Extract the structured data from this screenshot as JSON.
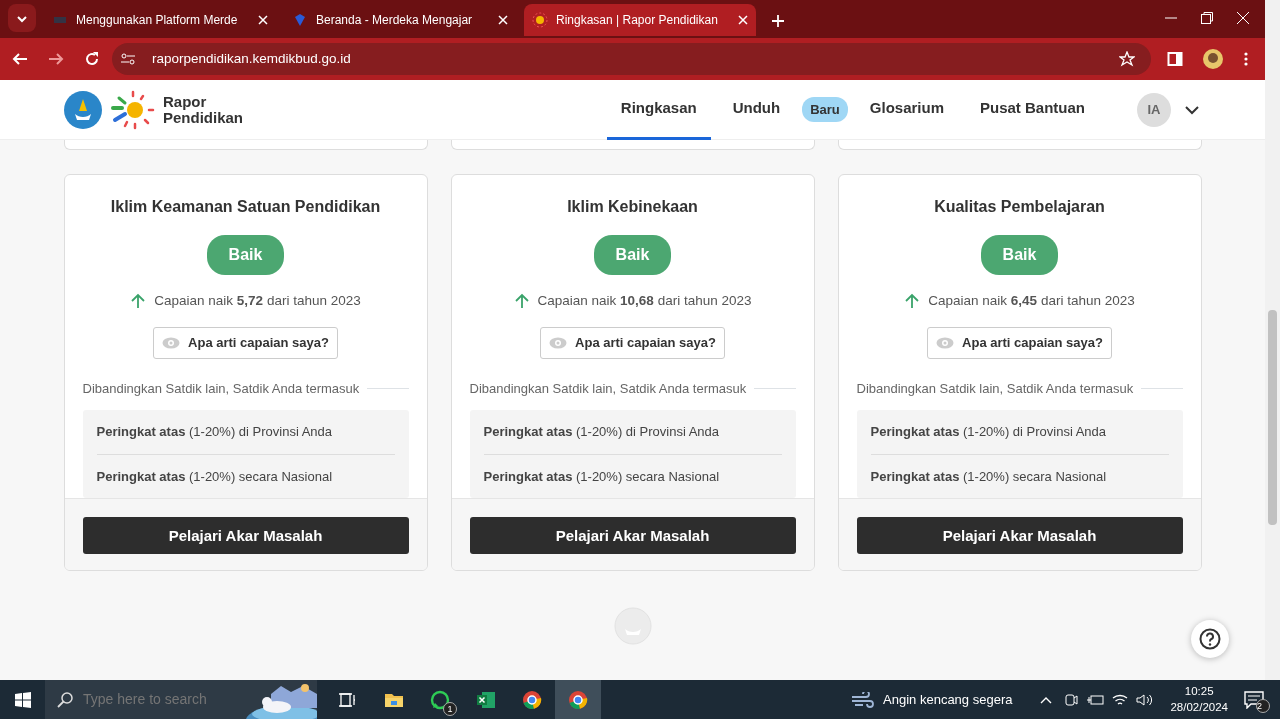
{
  "browser": {
    "tabs": [
      {
        "title": "Menggunakan Platform Merde",
        "selected": false
      },
      {
        "title": "Beranda - Merdeka Mengajar",
        "selected": false
      },
      {
        "title": "Ringkasan | Rapor Pendidikan",
        "selected": true
      }
    ],
    "address": "raporpendidikan.kemdikbud.go.id"
  },
  "header": {
    "brand": [
      "Rapor",
      "Pendidikan"
    ],
    "nav": [
      {
        "label": "Ringkasan",
        "selected": true
      },
      {
        "label": "Unduh",
        "selected": false,
        "badge": "Baru"
      },
      {
        "label": "Glosarium",
        "selected": false
      },
      {
        "label": "Pusat Bantuan",
        "selected": false
      }
    ],
    "avatar": "IA"
  },
  "cards": [
    {
      "title": "Iklim Keamanan Satuan Pendidikan",
      "rating": "Baik",
      "change": "Capaian naik **5,72** dari tahun 2023",
      "info_button": "Apa arti capaian saya?",
      "comparison_label": "Dibandingkan Satdik lain, Satdik Anda termasuk",
      "rankings": [
        "**Peringkat atas** (1-20%) di Provinsi Anda",
        "**Peringkat atas** (1-20%) secara Nasional"
      ],
      "action": "Pelajari Akar Masalah"
    },
    {
      "title": "Iklim Kebinekaan",
      "rating": "Baik",
      "change": "Capaian naik **10,68** dari tahun 2023",
      "info_button": "Apa arti capaian saya?",
      "comparison_label": "Dibandingkan Satdik lain, Satdik Anda termasuk",
      "rankings": [
        "**Peringkat atas** (1-20%) di Provinsi Anda",
        "**Peringkat atas** (1-20%) secara Nasional"
      ],
      "action": "Pelajari Akar Masalah"
    },
    {
      "title": "Kualitas Pembelajaran",
      "rating": "Baik",
      "change": "Capaian naik **6,45** dari tahun 2023",
      "info_button": "Apa arti capaian saya?",
      "comparison_label": "Dibandingkan Satdik lain, Satdik Anda termasuk",
      "rankings": [
        "**Peringkat atas** (1-20%) di Provinsi Anda",
        "**Peringkat atas** (1-20%) secara Nasional"
      ],
      "action": "Pelajari Akar Masalah"
    }
  ],
  "taskbar": {
    "search_placeholder": "Type here to search",
    "apps": [
      {
        "kind": "taskview",
        "selected": false
      },
      {
        "kind": "folder",
        "selected": false
      },
      {
        "kind": "whatsapp",
        "selected": false,
        "badge": "1"
      },
      {
        "kind": "excel",
        "selected": false
      },
      {
        "kind": "chrome",
        "selected": false
      },
      {
        "kind": "chrome",
        "selected": true
      }
    ],
    "weather": "Angin kencang segera",
    "time": "10:25",
    "date": "28/02/2024",
    "notifications": "2"
  }
}
